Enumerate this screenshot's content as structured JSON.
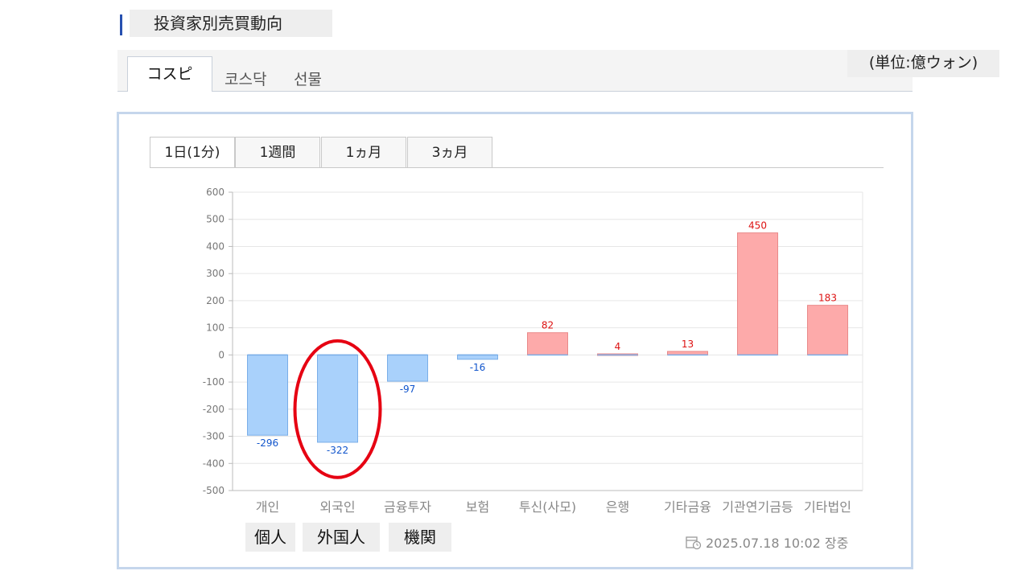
{
  "header": {
    "title": "投資家別売買動向"
  },
  "market_tabs": [
    {
      "label": "コスピ",
      "active": true
    },
    {
      "label": "코스닥",
      "active": false
    },
    {
      "label": "선물",
      "active": false
    }
  ],
  "unit_label": "(単位:億ウォン)",
  "period_tabs": [
    {
      "label": "1日(1分)",
      "active": true
    },
    {
      "label": "1週間",
      "active": false
    },
    {
      "label": "1ヵ月",
      "active": false
    },
    {
      "label": "3ヵ月",
      "active": false
    }
  ],
  "chart_data": {
    "type": "bar",
    "categories": [
      "개인",
      "외국인",
      "금융투자",
      "보험",
      "투신(사모)",
      "은행",
      "기타금융",
      "기관연기금등",
      "기타법인"
    ],
    "values": [
      -296,
      -322,
      -97,
      -16,
      82,
      4,
      13,
      450,
      183
    ],
    "y_ticks": [
      600,
      500,
      400,
      300,
      200,
      100,
      0,
      -100,
      -200,
      -300,
      -400,
      -500
    ],
    "ylim": [
      -500,
      600
    ],
    "grid": true,
    "colors": {
      "positive_fill": "#fdaaaa",
      "positive_stroke": "#e98a8a",
      "positive_label": "#dd1111",
      "negative_fill": "#a9d1fb",
      "negative_stroke": "#7aaee8",
      "negative_label": "#1155cc"
    }
  },
  "annotations": {
    "highlight_category": "외국인",
    "highlight_color": "#e60012",
    "category_notes": [
      "個人",
      "外国人",
      "機関"
    ]
  },
  "timestamp": "2025.07.18 10:02 장중",
  "icons": {
    "timestamp_icon": "clock-calendar-icon"
  }
}
